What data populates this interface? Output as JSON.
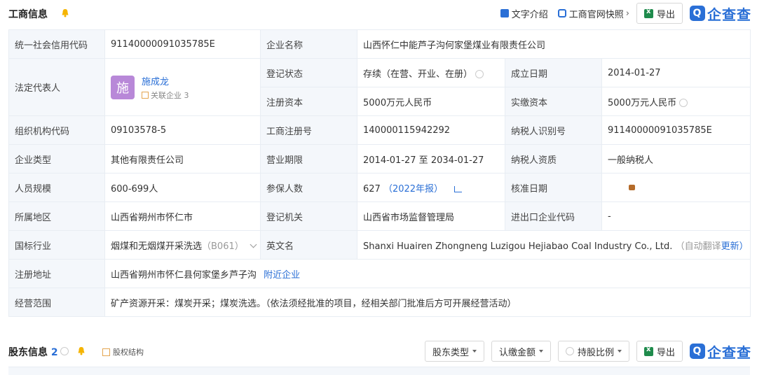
{
  "business_section": {
    "title": "工商信息",
    "text_intro": "文字介绍",
    "snapshot": "工商官网快照",
    "export": "导出",
    "logo": "企查查"
  },
  "fields": {
    "credit_code_label": "统一社会信用代码",
    "credit_code": "91140000091035785E",
    "company_name_label": "企业名称",
    "company_name": "山西怀仁中能芦子沟何家堡煤业有限责任公司",
    "legal_rep_label": "法定代表人",
    "legal_rep_avatar": "施",
    "legal_rep_name": "施成龙",
    "related_companies": "关联企业 3",
    "reg_status_label": "登记状态",
    "reg_status": "存续（在营、开业、在册）",
    "est_date_label": "成立日期",
    "est_date": "2014-01-27",
    "reg_capital_label": "注册资本",
    "reg_capital": "5000万元人民币",
    "paid_capital_label": "实缴资本",
    "paid_capital": "5000万元人民币",
    "org_code_label": "组织机构代码",
    "org_code": "09103578-5",
    "biz_reg_no_label": "工商注册号",
    "biz_reg_no": "140000115942292",
    "taxpayer_id_label": "纳税人识别号",
    "taxpayer_id": "91140000091035785E",
    "company_type_label": "企业类型",
    "company_type": "其他有限责任公司",
    "term_label": "营业期限",
    "term": "2014-01-27 至 2034-01-27",
    "taxpayer_qual_label": "纳税人资质",
    "taxpayer_qual": "一般纳税人",
    "staff_size_label": "人员规模",
    "staff_size": "600-699人",
    "insured_label": "参保人数",
    "insured": "627",
    "insured_year": "（2022年报）",
    "approval_date_label": "核准日期",
    "region_label": "所属地区",
    "region": "山西省朔州市怀仁市",
    "reg_authority_label": "登记机关",
    "reg_authority": "山西省市场监督管理局",
    "import_export_label": "进出口企业代码",
    "import_export": "-",
    "industry_label": "国标行业",
    "industry": "烟煤和无烟煤开采洗选",
    "industry_code": "（B061）",
    "english_name_label": "英文名",
    "english_name": "Shanxi Huairen Zhongneng Luzigou Hejiabao Coal Industry Co., Ltd.",
    "auto_translate": "（自动翻译",
    "update": "更新）",
    "address_label": "注册地址",
    "address": "山西省朔州市怀仁县何家堡乡芦子沟",
    "nearby": "附近企业",
    "scope_label": "经营范围",
    "scope": "矿产资源开采：煤炭开采；煤炭洗选。（依法须经批准的项目，经相关部门批准后方可开展经营活动）"
  },
  "shareholder_section": {
    "title": "股东信息",
    "count": "2",
    "structure": "股权结构",
    "type_filter": "股东类型",
    "amount_filter": "认缴金额",
    "ratio_filter": "持股比例",
    "export": "导出",
    "logo": "企查查"
  },
  "colors": {
    "accent": "#2a6fd6",
    "label_bg": "#f4f7fb",
    "bell": "#f5b400",
    "avatar": "#b888d8"
  }
}
